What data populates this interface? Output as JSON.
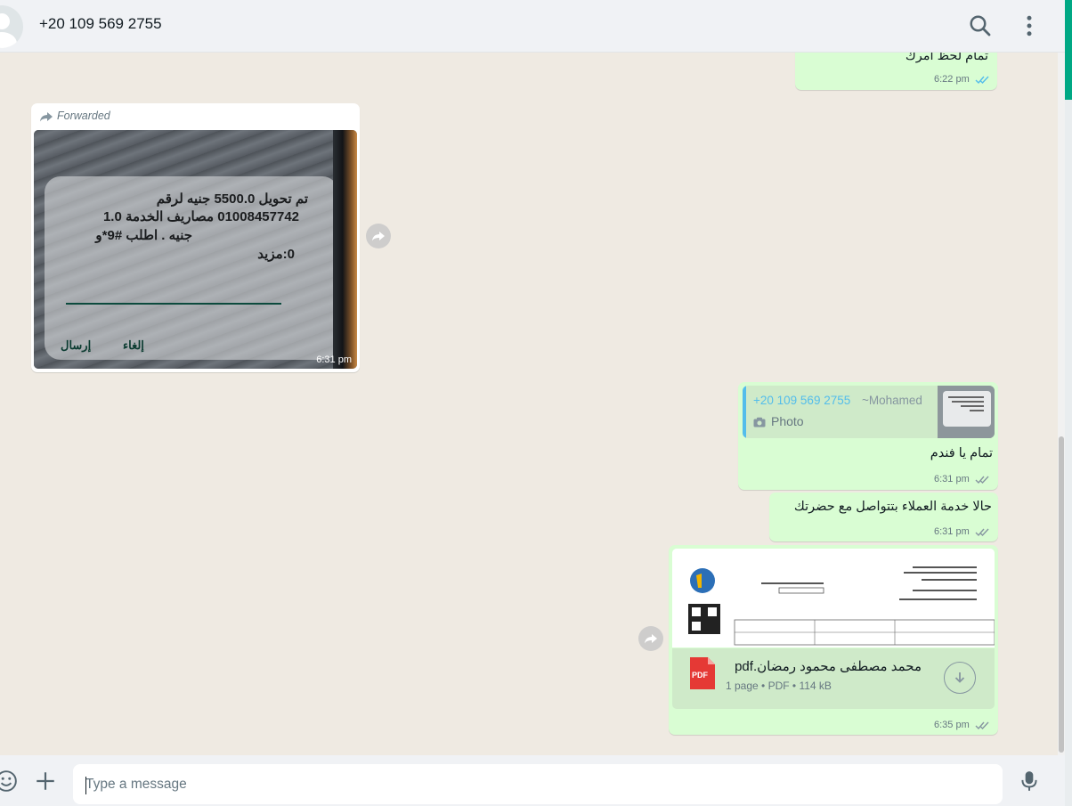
{
  "header": {
    "contact_name": "+20 109 569 2755"
  },
  "messages": {
    "m1": {
      "text": "تمام لحظ امرك",
      "time": "6:22 pm"
    },
    "m2": {
      "forwarded_label": "Forwarded",
      "photo_lines": [
        "تم تحويل 5500.0 جنيه لرقم",
        "01008457742 مصاريف الخدمة 1.0",
        "جنيه . اطلب #9*و",
        "0:مزيد"
      ],
      "photo_buttons": [
        "إرسال",
        "إلغاء"
      ],
      "time": "6:31 pm"
    },
    "m3": {
      "quote_phone": "+20 109 569 2755",
      "quote_author": "~Mohamed",
      "quote_type": "Photo",
      "text": "تمام يا فندم",
      "time": "6:31 pm"
    },
    "m4": {
      "text": "حالا خدمة العملاء بتتواصل مع حضرتك",
      "time": "6:31 pm"
    },
    "m5": {
      "file_name": "محمد مصطفى محمود رمضان.pdf",
      "file_meta": "1 page • PDF • 114 kB",
      "file_badge": "PDF",
      "time": "6:35 pm"
    }
  },
  "footer": {
    "placeholder": "Type a message"
  },
  "colors": {
    "outgoing_bubble": "#d9fdd3",
    "incoming_bubble": "#ffffff",
    "read_ticks": "#53bdeb",
    "chat_bg": "#efeae2",
    "accent": "#00a884"
  }
}
